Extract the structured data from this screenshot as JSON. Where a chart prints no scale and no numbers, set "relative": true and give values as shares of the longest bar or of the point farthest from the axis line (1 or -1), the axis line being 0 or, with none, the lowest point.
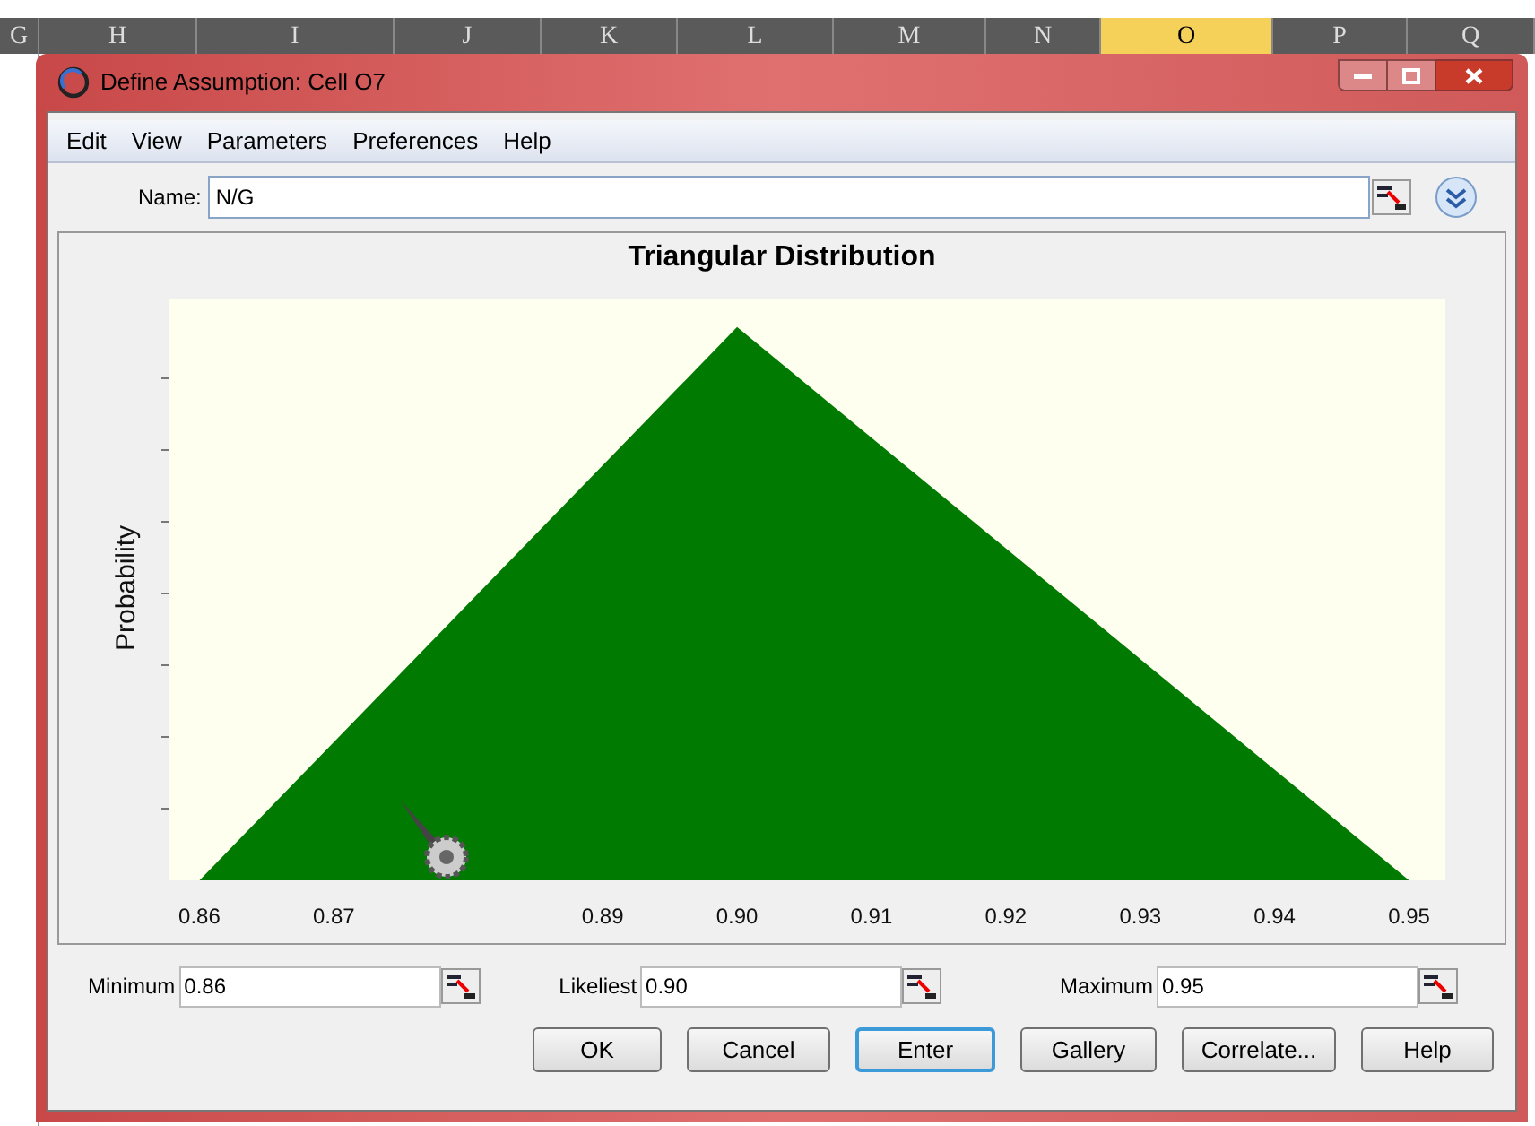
{
  "sheet_columns": [
    {
      "label": "G",
      "selected": false
    },
    {
      "label": "H",
      "selected": false
    },
    {
      "label": "I",
      "selected": false
    },
    {
      "label": "J",
      "selected": false
    },
    {
      "label": "K",
      "selected": false
    },
    {
      "label": "L",
      "selected": false
    },
    {
      "label": "M",
      "selected": false
    },
    {
      "label": "N",
      "selected": false
    },
    {
      "label": "O",
      "selected": true
    },
    {
      "label": "P",
      "selected": false
    },
    {
      "label": "Q",
      "selected": false
    }
  ],
  "window": {
    "title": "Define Assumption: Cell O7"
  },
  "menu": [
    "Edit",
    "View",
    "Parameters",
    "Preferences",
    "Help"
  ],
  "name_field": {
    "label": "Name:",
    "value": "N/G"
  },
  "chart": {
    "chart_data": {
      "type": "area",
      "title": "Triangular Distribution",
      "ylabel": "Probability",
      "x": [
        0.86,
        0.9,
        0.95
      ],
      "series": [
        {
          "color": "#007a00",
          "values": [
            0,
            1,
            0
          ]
        }
      ],
      "relative": true,
      "xlim": [
        0.8577,
        0.9527
      ],
      "xticks": [
        {
          "value": 0.86,
          "label": "0.86"
        },
        {
          "value": 0.87,
          "label": "0.87"
        },
        {
          "value": 0.89,
          "label": "0.89"
        },
        {
          "value": 0.9,
          "label": "0.90"
        },
        {
          "value": 0.91,
          "label": "0.91"
        },
        {
          "value": 0.92,
          "label": "0.92"
        },
        {
          "value": 0.93,
          "label": "0.93"
        },
        {
          "value": 0.94,
          "label": "0.94"
        },
        {
          "value": 0.95,
          "label": "0.95"
        }
      ]
    }
  },
  "parameters": [
    {
      "label": "Minimum",
      "value": "0.86"
    },
    {
      "label": "Likeliest",
      "value": "0.90"
    },
    {
      "label": "Maximum",
      "value": "0.95"
    }
  ],
  "buttons": [
    {
      "label": "OK",
      "focused": false
    },
    {
      "label": "Cancel",
      "focused": false
    },
    {
      "label": "Enter",
      "focused": true
    },
    {
      "label": "Gallery",
      "focused": false
    },
    {
      "label": "Correlate...",
      "focused": false
    },
    {
      "label": "Help",
      "focused": false
    }
  ]
}
